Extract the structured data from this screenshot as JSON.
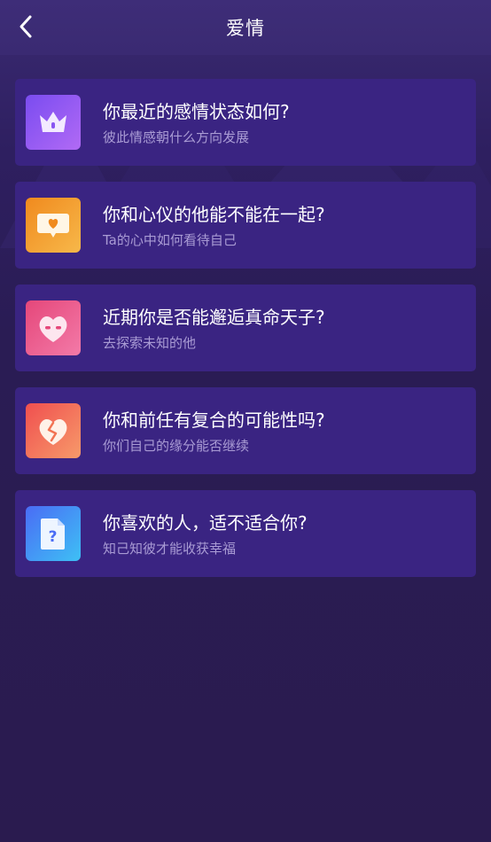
{
  "header": {
    "title": "爱情",
    "back_icon": "chevron-left-icon"
  },
  "cards": [
    {
      "title": "你最近的感情状态如何?",
      "subtitle": "彼此情感朝什么方向发展",
      "icon": "crown-icon",
      "gradient": [
        "#7a4cf0",
        "#b16af5"
      ]
    },
    {
      "title": "你和心仪的他能不能在一起?",
      "subtitle": "Ta的心中如何看待自己",
      "icon": "heart-message-icon",
      "gradient": [
        "#f08a1e",
        "#f7b84a"
      ]
    },
    {
      "title": "近期你是否能邂逅真命天子?",
      "subtitle": "去探索未知的他",
      "icon": "heart-face-icon",
      "gradient": [
        "#e5477a",
        "#f37aa8"
      ]
    },
    {
      "title": "你和前任有复合的可能性吗?",
      "subtitle": "你们自己的缘分能否继续",
      "icon": "broken-heart-icon",
      "gradient": [
        "#f04f4f",
        "#f79a6a"
      ]
    },
    {
      "title": "你喜欢的人，适不适合你?",
      "subtitle": "知己知彼才能收获幸福",
      "icon": "question-document-icon",
      "gradient": [
        "#4a6cf5",
        "#3ec0f5"
      ]
    }
  ]
}
